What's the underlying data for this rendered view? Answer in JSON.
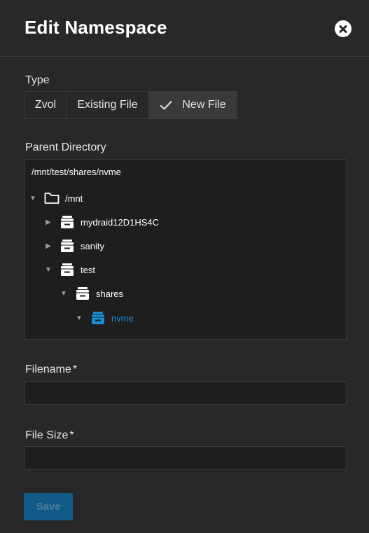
{
  "dialog": {
    "title": "Edit Namespace"
  },
  "type": {
    "label": "Type",
    "options": [
      "Zvol",
      "Existing File",
      "New File"
    ],
    "selected": "New File"
  },
  "parent_directory": {
    "label": "Parent Directory",
    "value": "/mnt/test/shares/nvme",
    "tree": [
      {
        "label": "/mnt"
      },
      {
        "label": "mydraid12D1HS4C"
      },
      {
        "label": "sanity"
      },
      {
        "label": "test"
      },
      {
        "label": "shares"
      },
      {
        "label": "nvme"
      }
    ]
  },
  "filename": {
    "label": "Filename",
    "required_mark": "*",
    "value": ""
  },
  "file_size": {
    "label": "File Size",
    "required_mark": "*",
    "value": ""
  },
  "actions": {
    "save_label": "Save"
  },
  "colors": {
    "background": "#282828",
    "accent": "#1a8fd6",
    "save_button": "#0f5a86"
  }
}
